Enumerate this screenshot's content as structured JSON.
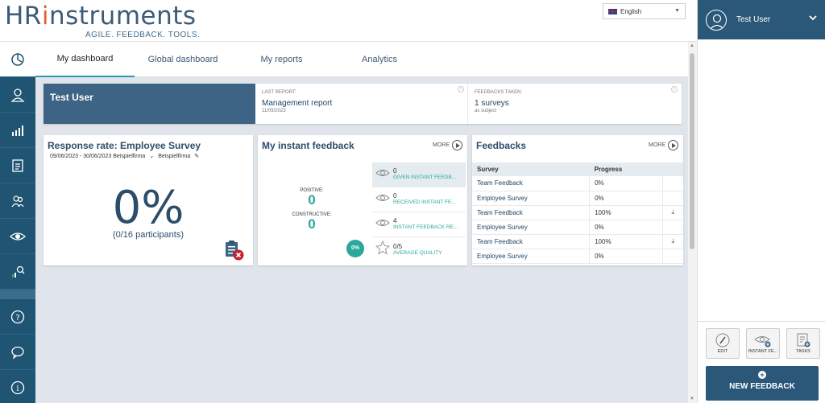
{
  "header": {
    "logo_prefix": "HR",
    "logo_i": "i",
    "logo_rest": "nstruments",
    "tagline": "AGILE. FEEDBACK. TOOLS.",
    "language": "English"
  },
  "tabs": [
    {
      "label": "My dashboard",
      "active": true
    },
    {
      "label": "Global dashboard"
    },
    {
      "label": "My reports"
    },
    {
      "label": "Analytics"
    }
  ],
  "summary": {
    "user_name": "Test User",
    "last_report_label": "LAST REPORT:",
    "last_report_value": "Management report",
    "last_report_date": "11/09/2023",
    "feedbacks_label": "FEEDBACKS TAKEN:",
    "feedbacks_value": "1 surveys",
    "feedbacks_sub": "as subject"
  },
  "response_rate": {
    "title": "Response rate: Employee Survey",
    "dates": "09/06/2023 - 30/06/2023 Beispielfirma",
    "company": "Beispielfirma",
    "percent": "0%",
    "participants": "(0/16 participants)",
    "progress_value": 0
  },
  "instant_feedback": {
    "title": "My instant feedback",
    "more_label": "MORE",
    "positive_label": "POSITIVE:",
    "positive_value": "0",
    "constructive_label": "CONSTRUCTIVE:",
    "constructive_value": "0",
    "ratio": "0%",
    "items": [
      {
        "count": "0",
        "label": "GIVEN INSTANT FEEDB..."
      },
      {
        "count": "0",
        "label": "RECEIVED INSTANT FE..."
      },
      {
        "count": "4",
        "label": "INSTANT FEEDBACK RE..."
      },
      {
        "count": "0/5",
        "label": "AVERAGE QUALITY"
      }
    ]
  },
  "feedbacks": {
    "title": "Feedbacks",
    "more_label": "MORE",
    "col_survey": "Survey",
    "col_progress": "Progress",
    "download_icon": "download-icon",
    "rows": [
      {
        "survey": "Team Feedback",
        "progress": "0%",
        "download": false
      },
      {
        "survey": "Employee Survey",
        "progress": "0%",
        "download": false
      },
      {
        "survey": "Team Feedback",
        "progress": "100%",
        "download": true
      },
      {
        "survey": "Employee Survey",
        "progress": "0%",
        "download": false
      },
      {
        "survey": "Team Feedback",
        "progress": "100%",
        "download": true
      },
      {
        "survey": "Employee Survey",
        "progress": "0%",
        "download": false
      }
    ]
  },
  "right_panel": {
    "user_name": "Test User",
    "edit_label": "EDIT",
    "instant_label": "INSTANT FE...",
    "tasks_label": "TASKS",
    "new_feedback_label": "NEW FEEDBACK"
  },
  "colors": {
    "brand": "#2b5878",
    "accent": "#e8602c",
    "teal": "#2aa89a"
  }
}
